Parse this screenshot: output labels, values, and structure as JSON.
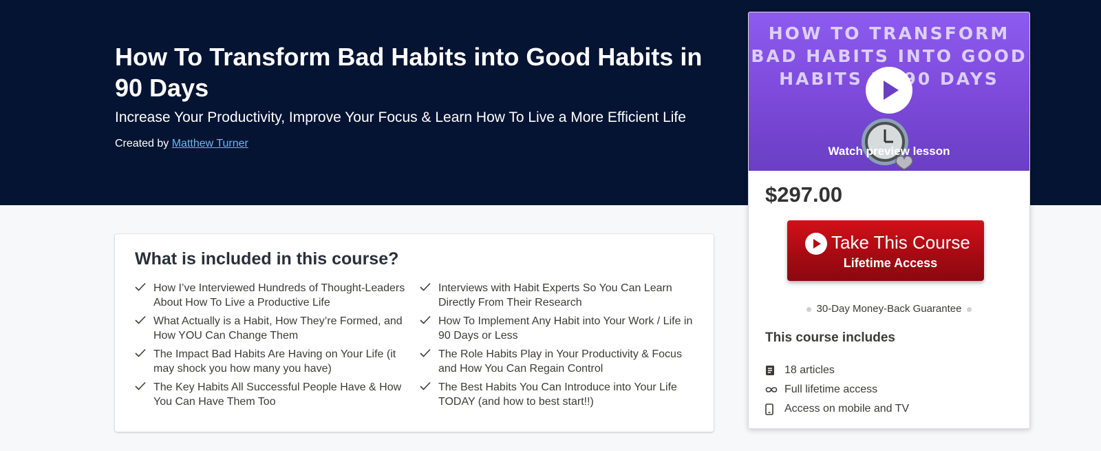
{
  "hero": {
    "title": "How To Transform Bad Habits into Good Habits in 90 Days",
    "subtitle": "Increase Your Productivity, Improve Your Focus & Learn How To Live a More Efficient Life",
    "created_by_prefix": "Created by",
    "author": "Matthew Turner"
  },
  "included": {
    "title": "What is included in this course?",
    "items": [
      "How I’ve Interviewed Hundreds of Thought-Leaders About How To Live a Productive Life",
      "Interviews with Habit Experts So You Can Learn Directly From Their Research",
      "What Actually is a Habit, How They’re Formed, and How YOU Can Change Them",
      "How To Implement Any Habit into Your Work / Life in 90 Days or Less",
      "The Impact Bad Habits Are Having on Your Life (it may shock you how many you have)",
      "The Role Habits Play in Your Productivity & Focus and How You Can Regain Control",
      "The Key Habits All Successful People Have & How You Can Have Them Too",
      "The Best Habits You Can Introduce into Your Life TODAY (and how to best start!!)"
    ]
  },
  "sidebar": {
    "preview": {
      "image_text": "HOW TO TRANSFORM BAD HABITS INTO GOOD HABITS IN 90 DAYS",
      "watch_label": "Watch preview lesson"
    },
    "price": "$297.00",
    "buy": {
      "main": "Take This Course",
      "sub": "Lifetime Access"
    },
    "guarantee": "30-Day Money-Back Guarantee",
    "includes_title": "This course includes",
    "includes": [
      {
        "icon": "article-icon",
        "label": "18 articles"
      },
      {
        "icon": "infinity-icon",
        "label": "Full lifetime access"
      },
      {
        "icon": "mobile-icon",
        "label": "Access on mobile and TV"
      }
    ]
  },
  "colors": {
    "hero_bg": "#051432",
    "link": "#69b8ef",
    "buy_button": "#c20e17",
    "preview_bg": "#8d5bf0"
  }
}
